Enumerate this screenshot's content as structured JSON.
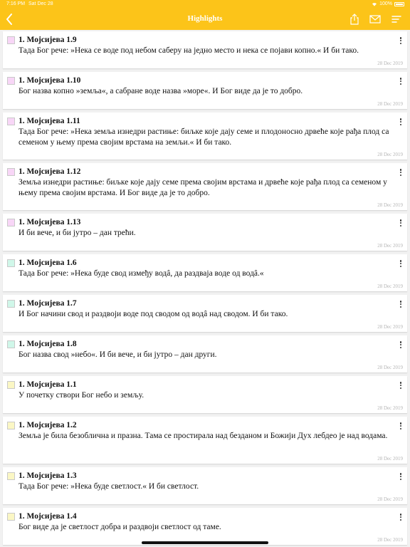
{
  "status": {
    "time": "7:16 PM",
    "date": "Sat Dec 28",
    "battery": "100%"
  },
  "header": {
    "title": "Highlights",
    "back_icon": "chevron-left-icon",
    "share_icon": "share-icon",
    "mail_icon": "mail-icon",
    "sort_icon": "sort-icon"
  },
  "colors": {
    "accent": "#fcc419",
    "pink": "#f8d6f7",
    "mint": "#d0f7e9",
    "yellow": "#fbf7c4"
  },
  "highlights": [
    {
      "ref": "1. Мојсијева 1.9",
      "text": "Тада Бог рече: »Нека се воде под небом саберу на једно место и нека се појави копно.« И би тако.",
      "date": "28 Dec 2019",
      "color": "#f8d6f7"
    },
    {
      "ref": "1. Мојсијева 1.10",
      "text": "Бог назва копно »земља«, а сабране воде назва »море«. И Бог виде да је то добро.",
      "date": "28 Dec 2019",
      "color": "#f8d6f7"
    },
    {
      "ref": "1. Мојсијева 1.11",
      "text": "Тада Бог рече: »Нека земља изнедри растиње: биљке које дају семе и плодоносно дрвеће које рађа плод са семеном у њему према својим врстама на земљи.« И би тако.",
      "date": "28 Dec 2019",
      "color": "#f8d6f7"
    },
    {
      "ref": "1. Мојсијева 1.12",
      "text": "Земља изнедри растиње: биљке које дају семе према својим врстама и дрвеће које рађа плод са семеном у њему према својим врстама. И Бог виде да је то добро.",
      "date": "28 Dec 2019",
      "color": "#f8d6f7"
    },
    {
      "ref": "1. Мојсијева 1.13",
      "text": "И би вече, и би јутро – дан трећи.",
      "date": "28 Dec 2019",
      "color": "#f8d6f7"
    },
    {
      "ref": "1. Мојсијева 1.6",
      "text": "Тада Бог рече: »Нека буде свод између водâ, да раздваја воде од водâ.«",
      "date": "28 Dec 2019",
      "color": "#d0f7e9"
    },
    {
      "ref": "1. Мојсијева 1.7",
      "text": "И Бог начини свод и раздвоји воде под сводом од водâ над сводом. И би тако.",
      "date": "28 Dec 2019",
      "color": "#d0f7e9"
    },
    {
      "ref": "1. Мојсијева 1.8",
      "text": "Бог назва свод »небо«. И би вече, и би јутро – дан други.",
      "date": "28 Dec 2019",
      "color": "#d0f7e9"
    },
    {
      "ref": "1. Мојсијева 1.1",
      "text": "У почетку створи Бог небо и земљу.",
      "date": "28 Dec 2019",
      "color": "#fbf7c4"
    },
    {
      "ref": "1. Мојсијева 1.2",
      "text": "Земља је била безоблична и празна. Тама се простирала над безданом и Божији Дух лебдео је над водама.",
      "date": "28 Dec 2019",
      "color": "#fbf7c4"
    },
    {
      "ref": "1. Мојсијева 1.3",
      "text": "Тада Бог рече: »Нека буде светлост.« И би светлост.",
      "date": "28 Dec 2019",
      "color": "#fbf7c4"
    },
    {
      "ref": "1. Мојсијева 1.4",
      "text": "Бог виде да је светлост добра и раздвоји светлост од таме.",
      "date": "28 Dec 2019",
      "color": "#fbf7c4"
    }
  ]
}
